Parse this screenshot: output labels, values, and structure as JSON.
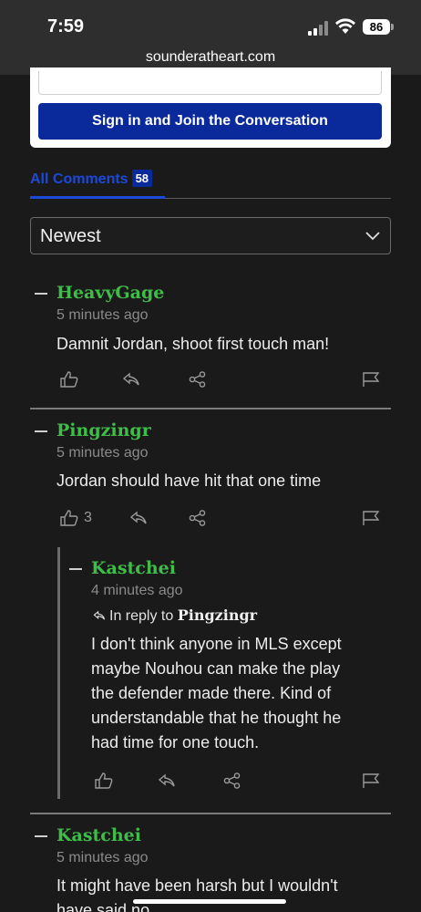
{
  "status": {
    "time": "7:59",
    "battery": "86"
  },
  "browser": {
    "url": "sounderatheart.com"
  },
  "signin": {
    "button_label": "Sign in and Join the Conversation"
  },
  "tabs": {
    "all_comments_label": "All Comments",
    "count": "58"
  },
  "sort": {
    "selected": "Newest"
  },
  "comments": [
    {
      "author": "HeavyGage",
      "time": "5 minutes ago",
      "text": "Damnit Jordan, shoot first touch man!"
    },
    {
      "author": "Pingzingr",
      "time": "5 minutes ago",
      "text": "Jordan should have hit that one time",
      "likes": "3"
    },
    {
      "author": "Kastchei",
      "time": "4 minutes ago",
      "in_reply_label": "In reply to",
      "in_reply_to": "Pingzingr",
      "lines": [
        "I don't think anyone in MLS except",
        "maybe Nouhou can make the play",
        "the defender made there. Kind of",
        "understandable that he thought he",
        "had time for one touch."
      ]
    },
    {
      "author": "Kastchei",
      "time": "5 minutes ago",
      "lines": [
        "It might have been harsh but I wouldn't",
        "have said no"
      ]
    }
  ],
  "colors": {
    "author": "#3fbd48",
    "accent": "#0a2a9c",
    "background": "#1a1a1a"
  }
}
